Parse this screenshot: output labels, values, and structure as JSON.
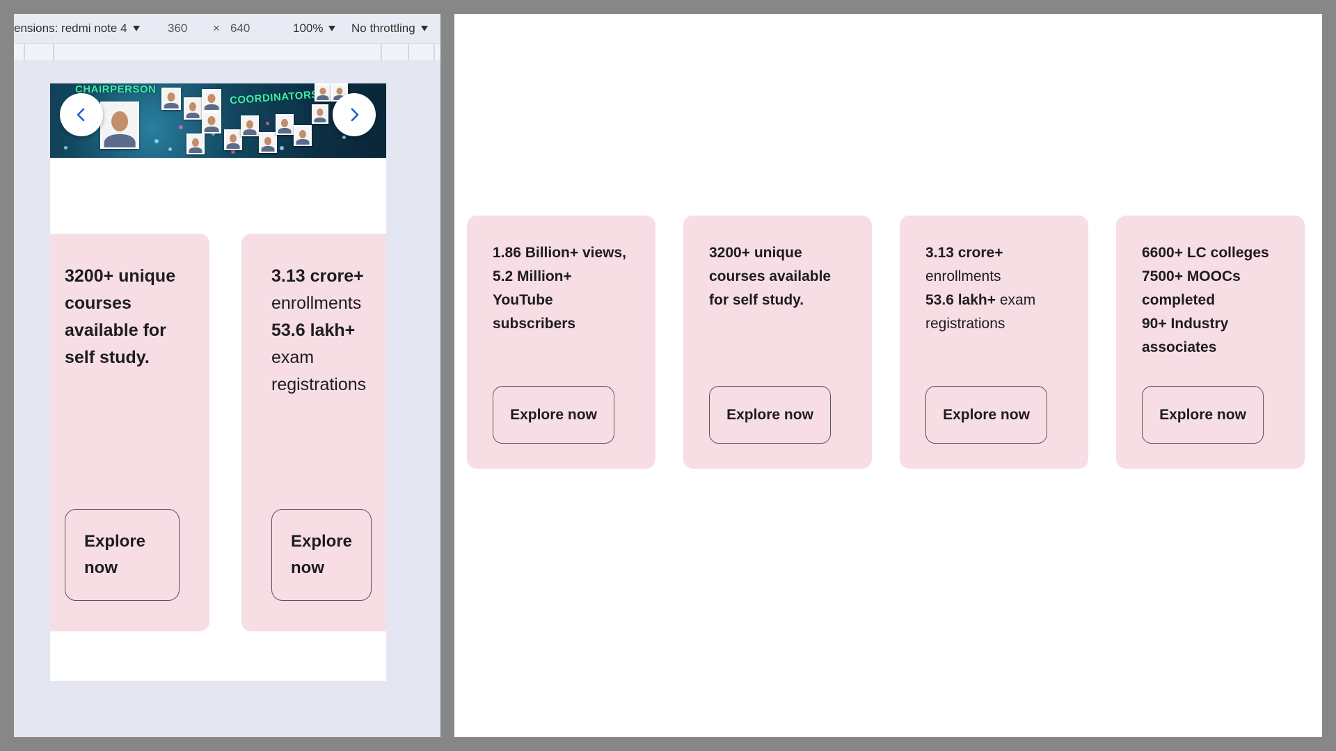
{
  "devtools": {
    "dimensions_label": "ensions: redmi note 4",
    "width": "360",
    "times": "×",
    "height": "640",
    "zoom": "100%",
    "throttling": "No throttling"
  },
  "mobile": {
    "banner": {
      "title_left": "CHAIRPERSON",
      "title_right": "COORDINATORS",
      "prev_icon": "chevron-left-icon",
      "next_icon": "chevron-right-icon"
    },
    "cards": [
      {
        "line1": "3200+ unique",
        "line2": "courses",
        "line3": "available for",
        "line4": "self study.",
        "btn_line1": "Explore",
        "btn_line2": "now"
      },
      {
        "line1_bold": "3.13 crore+",
        "line2": "enrollments",
        "line3_bold": "53.6 lakh+",
        "line4": "exam",
        "line5": "registrations",
        "btn_line1": "Explore",
        "btn_line2": "now"
      }
    ]
  },
  "desktop": {
    "cards": [
      {
        "line1": "1.86 Billion+ views,",
        "line2": "5.2 Million+",
        "line3": "YouTube",
        "line4": "subscribers",
        "button": "Explore now"
      },
      {
        "line1": "3200+ unique",
        "line2": "courses available",
        "line3": "for self study.",
        "button": "Explore now"
      },
      {
        "line1_bold": "3.13 crore+",
        "line2": "enrollments",
        "line3_bold": "53.6 lakh+",
        "line3_rest": " exam",
        "line4": "registrations",
        "button": "Explore now"
      },
      {
        "line1": "6600+ LC colleges",
        "line2": "7500+ MOOCs",
        "line3": "completed",
        "line4": "90+ Industry",
        "line5": "associates",
        "button": "Explore now"
      }
    ]
  },
  "colors": {
    "card_bg": "#f7dde4",
    "frame_bg": "#878787",
    "devtools_bg": "#e4e6f1",
    "accent_blue": "#1a5fd0"
  }
}
